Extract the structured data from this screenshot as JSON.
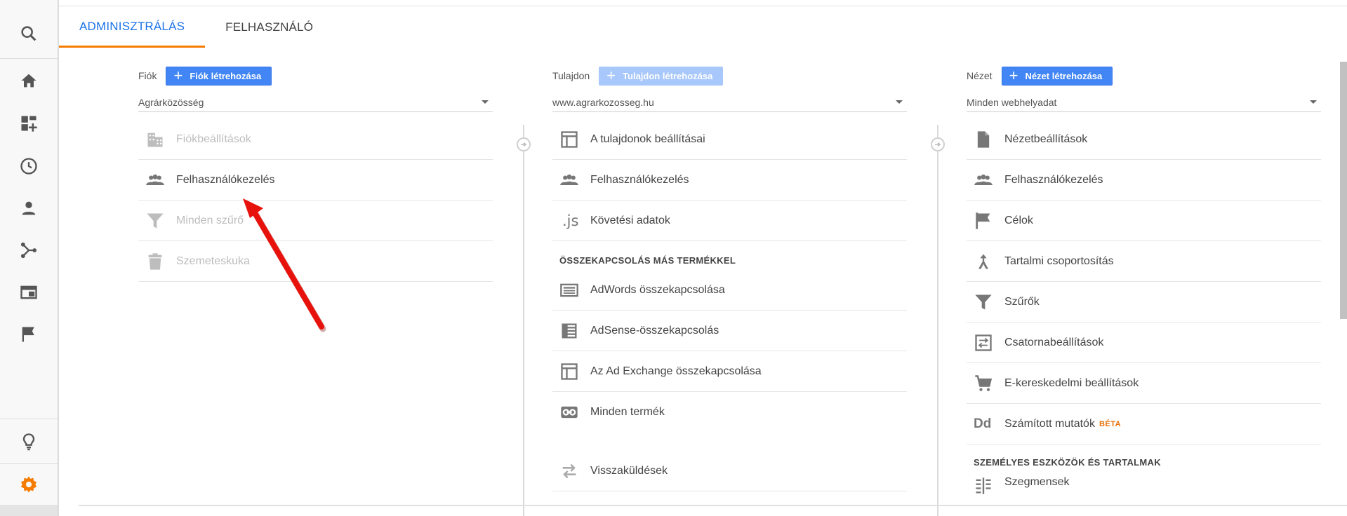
{
  "tabs": [
    {
      "label": "ADMINISZTRÁLÁS",
      "active": true
    },
    {
      "label": "FELHASZNÁLÓ",
      "active": false
    }
  ],
  "rail": {
    "items": [
      "search-icon",
      "home-icon",
      "dashboard-add-icon",
      "clock-icon",
      "person-icon",
      "acquisition-icon",
      "behavior-icon",
      "flag-icon",
      "lightbulb-icon",
      "gear-icon"
    ],
    "active_color": "#f57c00"
  },
  "account": {
    "label": "Fiók",
    "create_label": "Fiók létrehozása",
    "selected": "Agrárközösség",
    "rows": [
      {
        "label": "Fiókbeállítások",
        "icon": "building-icon",
        "dim": true
      },
      {
        "label": "Felhasználókezelés",
        "icon": "people-icon",
        "dim": false
      },
      {
        "label": "Minden szűrő",
        "icon": "filter-icon",
        "dim": true
      },
      {
        "label": "Szemeteskuka",
        "icon": "trash-icon",
        "dim": true
      }
    ]
  },
  "property": {
    "label": "Tulajdon",
    "create_label": "Tulajdon létrehozása",
    "selected": "www.agrarkozosseg.hu",
    "rows": [
      {
        "label": "A tulajdonok beállításai",
        "icon": "layout-icon"
      },
      {
        "label": "Felhasználókezelés",
        "icon": "people-icon"
      },
      {
        "label": "Követési adatok",
        "icon": "js-icon",
        "icon_text": ".js"
      }
    ],
    "section_title": "ÖSSZEKAPCSOLÁS MÁS TERMÉKKEL",
    "link_rows": [
      {
        "label": "AdWords összekapcsolása",
        "icon": "adwords-icon"
      },
      {
        "label": "AdSense-összekapcsolás",
        "icon": "adsense-icon"
      },
      {
        "label": "Az Ad Exchange összekapcsolása",
        "icon": "layout-icon"
      },
      {
        "label": "Minden termék",
        "icon": "link-icon"
      }
    ],
    "extra_rows": [
      {
        "label": "Visszaküldések",
        "icon": "postbacks-icon"
      }
    ]
  },
  "view": {
    "label": "Nézet",
    "create_label": "Nézet létrehozása",
    "selected": "Minden webhelyadat",
    "rows": [
      {
        "label": "Nézetbeállítások",
        "icon": "document-icon"
      },
      {
        "label": "Felhasználókezelés",
        "icon": "people-icon"
      },
      {
        "label": "Célok",
        "icon": "flag-icon"
      },
      {
        "label": "Tartalmi csoportosítás",
        "icon": "content-group-icon"
      },
      {
        "label": "Szűrők",
        "icon": "filter-icon"
      },
      {
        "label": "Csatornabeállítások",
        "icon": "channel-icon"
      },
      {
        "label": "E-kereskedelmi beállítások",
        "icon": "cart-icon"
      },
      {
        "label": "Számított mutatók",
        "icon": "dd-icon",
        "icon_text": "Dd",
        "badge": "BÉTA"
      }
    ],
    "section_title": "SZEMÉLYES ESZKÖZÖK ÉS TARTALMAK",
    "tool_rows": [
      {
        "label": "Szegmensek",
        "icon": "segments-icon"
      }
    ]
  },
  "colors": {
    "accent": "#4285f4",
    "tab_active": "#1a73e8",
    "tab_underline": "#f57c00",
    "annotation_arrow": "#e8120c"
  }
}
